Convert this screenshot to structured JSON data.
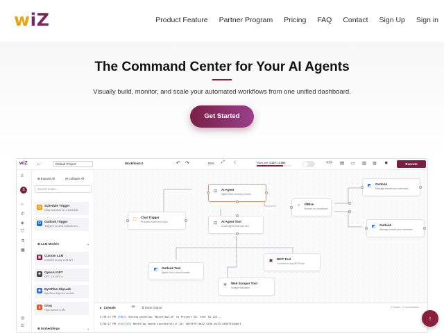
{
  "nav": {
    "logo": {
      "w": "w",
      "i": "i",
      "z": "Z"
    },
    "links": [
      "Product Feature",
      "Partner Program",
      "Pricing",
      "FAQ",
      "Contact",
      "Sign Up",
      "Sign in"
    ]
  },
  "hero": {
    "title": "The Command Center for Your AI Agents",
    "subtitle": "Visually build, monitor, and scale your automated workflows from one unified dashboard.",
    "cta": "Get Started"
  },
  "app": {
    "toolbar": {
      "logo": "wiZ",
      "project": "Default Project",
      "workflow": "Workflow2.0",
      "zoom": "90%",
      "runs_label": "Runs left:",
      "runs_value": "1,527 / 2,000",
      "runs_fraction": 0.76,
      "execute": "Execute"
    },
    "rail": {
      "avatar": "S"
    },
    "panel": {
      "expand_all": "Expand All",
      "collapse_all": "Collapse All",
      "search_placeholder": "Search nodes...",
      "triggers": [
        {
          "title": "Schedule Trigger",
          "desc": "Daily workflow on a schedule",
          "color": "#e4a51a",
          "icon": "clock-icon"
        },
        {
          "title": "Outlook Trigger",
          "desc": "Triggers on new Outlook em...",
          "color": "#1f6fd1",
          "icon": "outlook-icon"
        }
      ],
      "section_llm": "LLM Models",
      "llms": [
        {
          "title": "Custom LLM",
          "desc": "Connect to any LLM API",
          "color": "#7a1f44",
          "icon": "cpu-icon"
        },
        {
          "title": "OpenAI GPT",
          "desc": "GPT 3.5 GPT-4",
          "color": "#444444",
          "icon": "openai-icon"
        },
        {
          "title": "BytePlus SkyLark",
          "desc": "BytePlus SkyLark models",
          "color": "#3b6fd1",
          "icon": "byteplus-icon"
        },
        {
          "title": "Groq",
          "desc": "High-speed LLMs",
          "color": "#e05a2b",
          "icon": "groq-icon"
        }
      ],
      "section_embeddings": "Embeddings"
    },
    "nodes": {
      "chat_trigger": {
        "title": "Chat Trigger",
        "desc": "Provides more text input"
      },
      "ai_agent": {
        "title": "AI Agent",
        "desc": "Agent with memory & tools"
      },
      "ai_agent_tool": {
        "title": "AI Agent Tool",
        "desc": "A sub-agent that can act..."
      },
      "if_else": {
        "title": "If/Else",
        "desc": "Branch on conditions"
      },
      "outlook_top": {
        "title": "Outlook",
        "desc": "Manage emails and calendars"
      },
      "outlook_mid": {
        "title": "Outlook",
        "desc": "Manage emails and calendars"
      },
      "mcp_tool": {
        "title": "MCP Tool",
        "desc": "Connect to any MCP tool"
      },
      "outlook_tool": {
        "title": "Outlook Tool",
        "desc": "Agent tool to send emails"
      },
      "web_scraper": {
        "title": "Web Scraper Tool",
        "desc": "Scrape Websites"
      }
    },
    "console": {
      "tab_console": "Console",
      "console_badge": "10",
      "tab_node_output": "Node Output",
      "count": "0 nodes · 0 connections",
      "lines": [
        {
          "time": "5:38:17 PM",
          "level": "[INFO]",
          "msg": "Saving workflow \"Workflow2.0\" to Project ID: test 10 123..."
        },
        {
          "time": "5:38:17 PM",
          "level": "[SUCCESS]",
          "msg": "Workflow saved successfully! ID: 1819f79-4a22-423e-ac23-34097153dbf1"
        }
      ]
    }
  }
}
